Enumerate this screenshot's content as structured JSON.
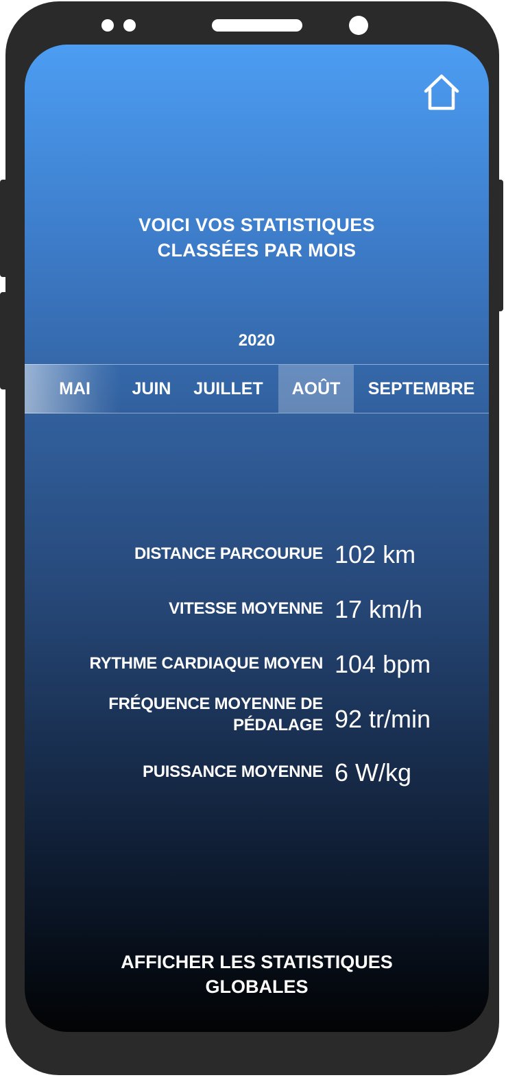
{
  "header": {
    "title_line1": "VOICI VOS STATISTIQUES",
    "title_line2": "CLASSÉES PAR MOIS",
    "home_icon": "home-icon"
  },
  "year": "2020",
  "months": [
    {
      "label": "MAI",
      "selected": false
    },
    {
      "label": "JUIN",
      "selected": false
    },
    {
      "label": "JUILLET",
      "selected": false
    },
    {
      "label": "AOÛT",
      "selected": true
    },
    {
      "label": "SEPTEMBRE",
      "selected": false
    }
  ],
  "stats": [
    {
      "label_line1": "DISTANCE PARCOURUE",
      "label_line2": "",
      "value": "102 km"
    },
    {
      "label_line1": "VITESSE MOYENNE",
      "label_line2": "",
      "value": "17 km/h"
    },
    {
      "label_line1": "RYTHME CARDIAQUE MOYEN",
      "label_line2": "",
      "value": "104 bpm"
    },
    {
      "label_line1": "FRÉQUENCE MOYENNE DE",
      "label_line2": "PÉDALAGE",
      "value": "92 tr/min"
    },
    {
      "label_line1": "PUISSANCE MOYENNE",
      "label_line2": "",
      "value": "6 W/kg"
    }
  ],
  "footer": {
    "line1": "AFFICHER LES STATISTIQUES",
    "line2": "GLOBALES"
  },
  "colors": {
    "gradient_top": "#4c9df3",
    "gradient_bottom": "#020304",
    "text": "#ffffff",
    "frame": "#2a2a2a"
  }
}
